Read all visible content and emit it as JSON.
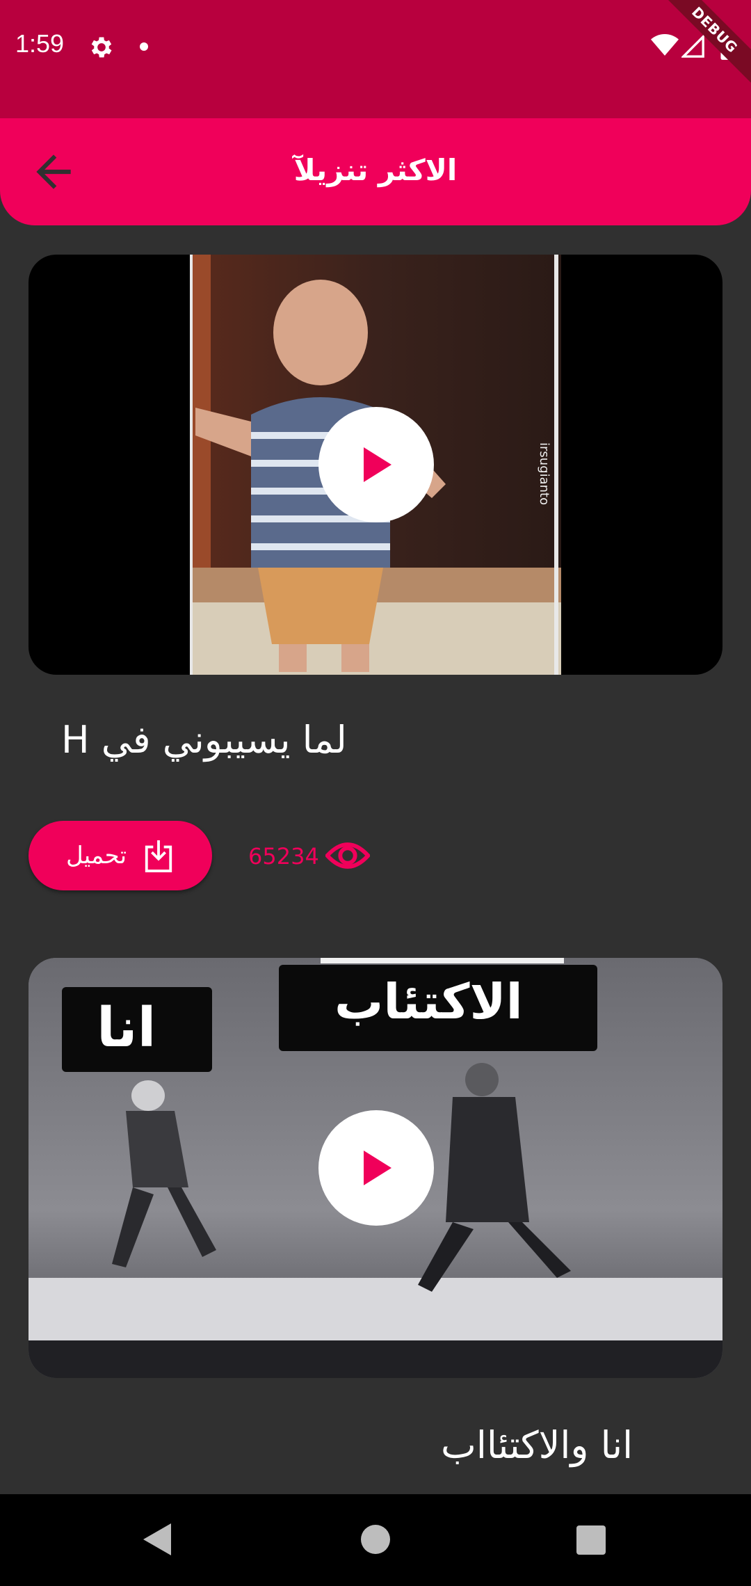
{
  "status_bar": {
    "time": "1:59",
    "icons": [
      "gear-icon",
      "notification-dot-icon",
      "wifi-icon",
      "signal-icon",
      "battery-icon"
    ],
    "debug_banner": "DEBUG"
  },
  "app_bar": {
    "title": "الاكثر تنزيلآ",
    "back_icon": "arrow-left-icon"
  },
  "videos": [
    {
      "title": "H لما يسيبوني في",
      "thumbnail_watermark": "irsugianto",
      "download_label": "تحميل",
      "views": "65234"
    },
    {
      "title": "انا والاكتئااب",
      "thumbnail_caption_left": "انا",
      "thumbnail_caption_right": "الاكتئاب"
    }
  ],
  "nav_bar": {
    "icons": [
      "nav-back-icon",
      "nav-home-icon",
      "nav-recents-icon"
    ]
  },
  "colors": {
    "status_bar": "#b8003e",
    "app_bar": "#f0005a",
    "accent": "#f0005a",
    "background": "#303030"
  }
}
